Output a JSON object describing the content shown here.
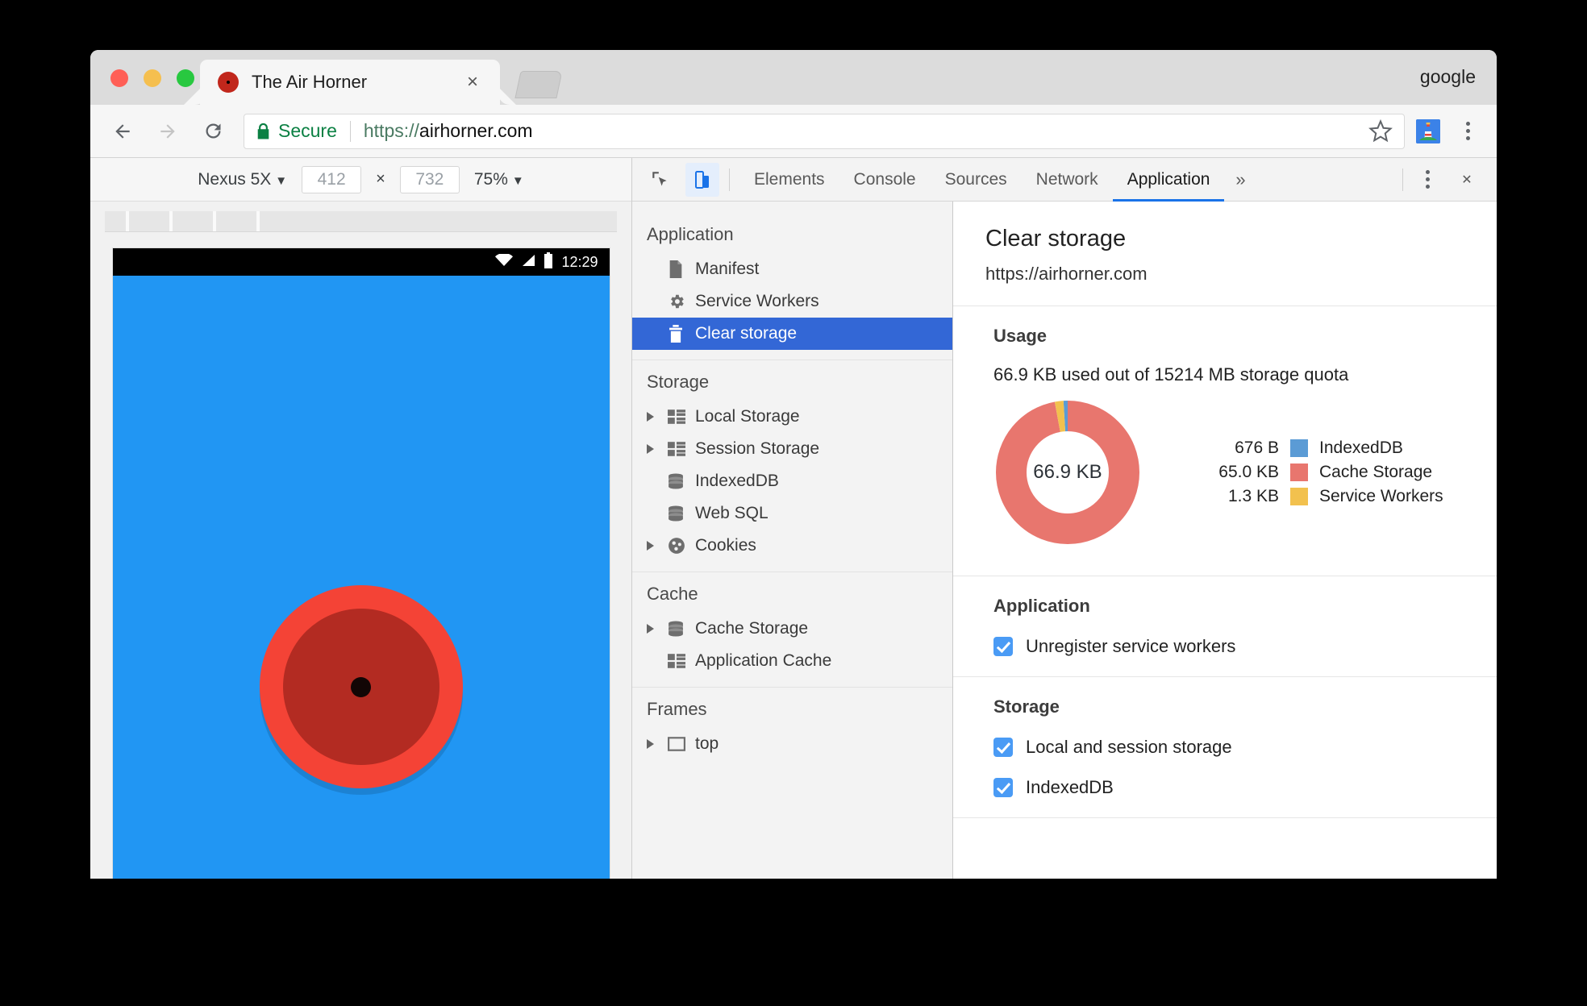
{
  "browser": {
    "profile_name": "google",
    "tab": {
      "title": "The Air Horner",
      "close_label": "×"
    },
    "nav": {
      "back": "←",
      "forward": "→",
      "reload": "↻"
    },
    "omnibox": {
      "secure_label": "Secure",
      "url_scheme": "https://",
      "url_host": "airhorner.com",
      "star_label": "☆"
    },
    "extension_icon": "lighthouse-icon",
    "menu_icon": "three-dot-menu-icon"
  },
  "device_toolbar": {
    "device": "Nexus 5X",
    "caret": "▼",
    "width": "412",
    "height": "732",
    "times": "×",
    "zoom": "75%"
  },
  "viewport": {
    "status_time": "12:29",
    "wifi_icon": "wifi-icon",
    "signal_icon": "cell-signal-icon",
    "battery_icon": "battery-icon",
    "background_color": "#2196f3",
    "horn_outer_color": "#f44336",
    "horn_inner_color": "#b32b22"
  },
  "devtools": {
    "inspect_icon": "inspect-element-icon",
    "device_toggle_icon": "device-toolbar-icon",
    "tabs": [
      {
        "label": "Elements",
        "active": false
      },
      {
        "label": "Console",
        "active": false
      },
      {
        "label": "Sources",
        "active": false
      },
      {
        "label": "Network",
        "active": false
      },
      {
        "label": "Application",
        "active": true
      }
    ],
    "more_tabs": "»",
    "kebab_icon": "devtools-menu-icon",
    "close_label": "✕",
    "accent_color": "#1a73e8",
    "sidebar": [
      {
        "heading": "Application",
        "items": [
          {
            "label": "Manifest",
            "icon": "document-icon",
            "expandable": false,
            "selected": false
          },
          {
            "label": "Service Workers",
            "icon": "gear-icon",
            "expandable": false,
            "selected": false
          },
          {
            "label": "Clear storage",
            "icon": "trash-icon",
            "expandable": false,
            "selected": true
          }
        ]
      },
      {
        "heading": "Storage",
        "items": [
          {
            "label": "Local Storage",
            "icon": "table-icon",
            "expandable": true,
            "selected": false
          },
          {
            "label": "Session Storage",
            "icon": "table-icon",
            "expandable": true,
            "selected": false
          },
          {
            "label": "IndexedDB",
            "icon": "database-icon",
            "expandable": false,
            "selected": false
          },
          {
            "label": "Web SQL",
            "icon": "database-icon",
            "expandable": false,
            "selected": false
          },
          {
            "label": "Cookies",
            "icon": "cookie-icon",
            "expandable": true,
            "selected": false
          }
        ]
      },
      {
        "heading": "Cache",
        "items": [
          {
            "label": "Cache Storage",
            "icon": "database-icon",
            "expandable": true,
            "selected": false
          },
          {
            "label": "Application Cache",
            "icon": "table-icon",
            "expandable": false,
            "selected": false
          }
        ]
      },
      {
        "heading": "Frames",
        "items": [
          {
            "label": "top",
            "icon": "frame-icon",
            "expandable": true,
            "selected": false
          }
        ]
      }
    ],
    "panel": {
      "title": "Clear storage",
      "origin": "https://airhorner.com",
      "usage_heading": "Usage",
      "usage_line": "66.9 KB used out of 15214 MB storage quota",
      "application_heading": "Application",
      "storage_heading": "Storage",
      "application_checks": [
        {
          "label": "Unregister service workers",
          "checked": true
        }
      ],
      "storage_checks": [
        {
          "label": "Local and session storage",
          "checked": true
        },
        {
          "label": "IndexedDB",
          "checked": true
        }
      ]
    }
  },
  "chart_data": {
    "type": "pie",
    "title": "Usage",
    "center_label": "66.9 KB",
    "total_bytes": 68505,
    "legend_position": "right",
    "categories": [
      "IndexedDB",
      "Cache Storage",
      "Service Workers"
    ],
    "values": [
      676,
      66560,
      1331
    ],
    "value_labels": [
      "676 B",
      "65.0 KB",
      "1.3 KB"
    ],
    "colors": [
      "#5b9bd5",
      "#e8766e",
      "#f2c14e"
    ],
    "slices": [
      {
        "name": "IndexedDB",
        "label": "676 B",
        "bytes": 676,
        "percent": 1.0,
        "color": "#5b9bd5"
      },
      {
        "name": "Cache Storage",
        "label": "65.0 KB",
        "bytes": 66560,
        "percent": 97.1,
        "color": "#e8766e"
      },
      {
        "name": "Service Workers",
        "label": "1.3 KB",
        "bytes": 1331,
        "percent": 1.9,
        "color": "#f2c14e"
      }
    ]
  }
}
